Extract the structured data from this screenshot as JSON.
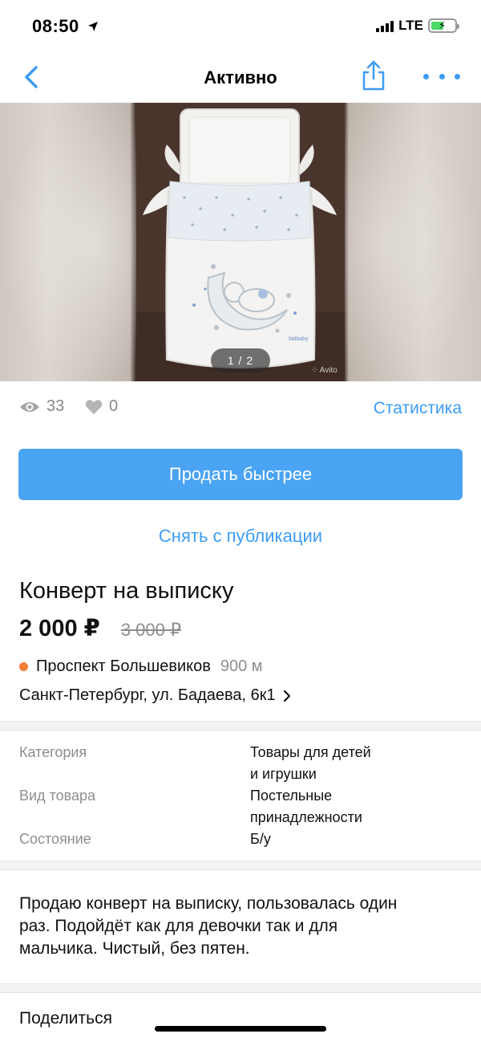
{
  "status_bar": {
    "time": "08:50",
    "network": "LTE",
    "location_icon": "location-arrow-icon",
    "battery_level": 0.55,
    "battery_charging": true
  },
  "nav": {
    "title": "Активно",
    "back_icon": "chevron-left-icon",
    "share_icon": "share-icon",
    "more_icon": "more-dots-icon"
  },
  "gallery": {
    "counter": "1 / 2",
    "watermark": "Avito"
  },
  "stats": {
    "views": "33",
    "likes": "0",
    "statistics_link": "Статистика"
  },
  "actions": {
    "sell_faster": "Продать быстрее",
    "unpublish": "Снять с публикации"
  },
  "listing": {
    "title": "Конверт на выписку",
    "price": "2 000 ₽",
    "old_price": "3 000 ₽",
    "metro_station": "Проспект Большевиков",
    "metro_distance": "900 м",
    "address": "Санкт-Петербург, ул. Бадаева, 6к1"
  },
  "params": [
    {
      "label": "Категория",
      "value_lines": [
        "Товары для детей",
        "и игрушки"
      ]
    },
    {
      "label": "Вид товара",
      "value_lines": [
        "Постельные",
        "принадлежности"
      ]
    },
    {
      "label": "Состояние",
      "value_lines": [
        "Б/у"
      ]
    }
  ],
  "description": [
    "Продаю конверт на выписку, пользовалась один",
    "раз. Подойдёт как для девочки так и для",
    "мальчика.  Чистый, без пятен."
  ],
  "share": {
    "title": "Поделиться"
  },
  "colors": {
    "accent": "#3d9cf5",
    "button": "#4aa3f3",
    "metro_orange": "#ef7e35",
    "muted": "#8e8e8e"
  }
}
